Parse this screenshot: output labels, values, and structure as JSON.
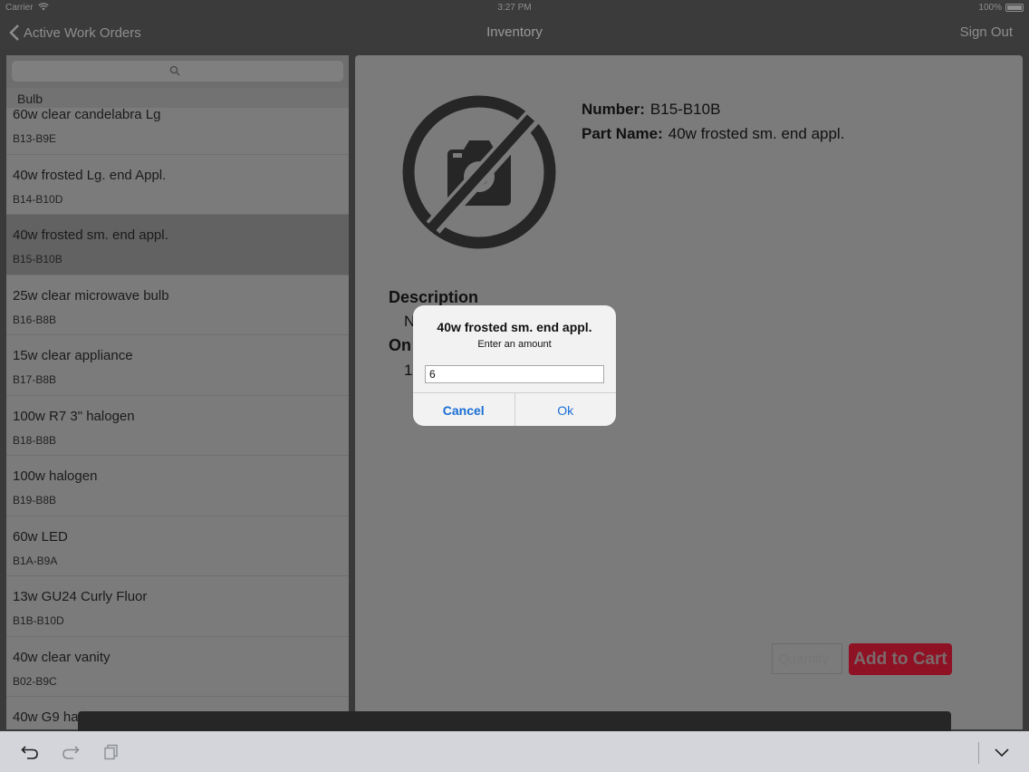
{
  "status_bar": {
    "carrier": "Carrier",
    "time": "3:27 PM",
    "battery": "100%"
  },
  "nav": {
    "back_label": "Active Work Orders",
    "title": "Inventory",
    "sign_out": "Sign Out"
  },
  "search": {
    "placeholder": ""
  },
  "list": {
    "section": "Bulb",
    "items": [
      {
        "name": "60w clear candelabra Lg",
        "code": "B13-B9E"
      },
      {
        "name": "40w frosted Lg. end Appl.",
        "code": "B14-B10D"
      },
      {
        "name": "40w frosted sm. end appl.",
        "code": "B15-B10B"
      },
      {
        "name": "25w clear microwave bulb",
        "code": "B16-B8B"
      },
      {
        "name": "15w clear appliance",
        "code": "B17-B8B"
      },
      {
        "name": "100w R7 3\" halogen",
        "code": "B18-B8B"
      },
      {
        "name": "100w halogen",
        "code": "B19-B8B"
      },
      {
        "name": "60w LED",
        "code": "B1A-B9A"
      },
      {
        "name": "13w GU24 Curly Fluor",
        "code": "B1B-B10D"
      },
      {
        "name": "40w clear vanity",
        "code": "B02-B9C"
      },
      {
        "name": "40w G9 ha",
        "code": ""
      }
    ]
  },
  "detail": {
    "number_label": "Number:",
    "number": "B15-B10B",
    "part_label": "Part Name:",
    "part_name": "40w frosted sm. end appl.",
    "description_label": "Description",
    "description_value": "N",
    "on_hand_label": "On",
    "on_hand_value": "1",
    "quantity_placeholder": "Quantity",
    "add_to_cart": "Add to Cart"
  },
  "dialog": {
    "title": "40w frosted sm. end appl.",
    "message": "Enter an amount",
    "value": "6",
    "cancel": "Cancel",
    "ok": "Ok"
  },
  "colors": {
    "accent": "#1a6fd6",
    "cart_button": "#8e1124"
  }
}
